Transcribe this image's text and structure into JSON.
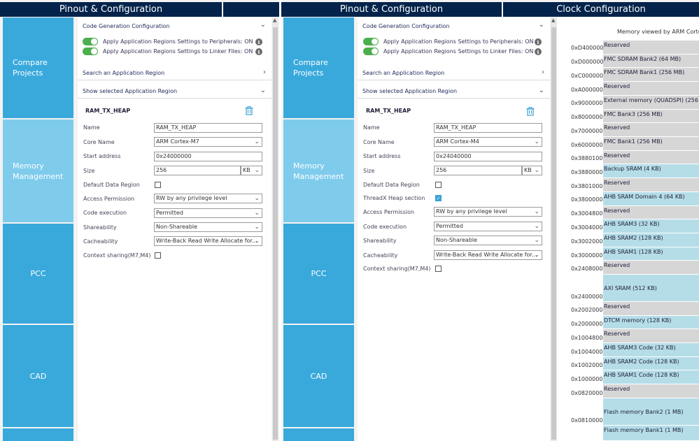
{
  "left": {
    "tabs": [
      "Pinout & Configuration"
    ],
    "sidebar": [
      {
        "label": "Compare Projects"
      },
      {
        "label": "Memory\nManagement"
      },
      {
        "label": "PCC"
      },
      {
        "label": "CAD"
      }
    ],
    "sections": {
      "code_gen": "Code Generation Configuration",
      "apply_periph": "Apply Application Regions Settings to Peripherals: ON",
      "apply_linker": "Apply Application Regions Settings to Linker Files: ON",
      "search": "Search an Application Region",
      "show_selected": "Show selected Application Region"
    },
    "region_title": "RAM_TX_HEAP",
    "fields": {
      "name_label": "Name",
      "name_value": "RAM_TX_HEAP",
      "core_label": "Core Name",
      "core_value": "ARM Cortex-M7",
      "start_label": "Start address",
      "start_value": "0x24000000",
      "size_label": "Size",
      "size_value": "256",
      "size_unit": "KB",
      "default_label": "Default Data Region",
      "access_label": "Access Permission",
      "access_value": "RW by any privilege level",
      "code_exec_label": "Code execution",
      "code_exec_value": "Permitted",
      "share_label": "Shareability",
      "share_value": "Non-Shareable",
      "cache_label": "Cacheability",
      "cache_value": "Write-Back Read Write Allocate for...",
      "context_label": "Context sharing(M7,M4)"
    }
  },
  "right": {
    "tabs": [
      "Pinout & Configuration",
      "Clock Configuration"
    ],
    "sidebar": [
      {
        "label": "Compare Projects"
      },
      {
        "label": "Memory\nManagement"
      },
      {
        "label": "PCC"
      },
      {
        "label": "CAD"
      }
    ],
    "sections": {
      "code_gen": "Code Generation Configuration",
      "apply_periph": "Apply Application Regions Settings to Peripherals: ON",
      "apply_linker": "Apply Application Regions Settings to Linker Files: ON",
      "search": "Search an Application Region",
      "show_selected": "Show selected Application Region"
    },
    "region_title": "RAM_TX_HEAP",
    "fields": {
      "name_label": "Name",
      "name_value": "RAM_TX_HEAP",
      "core_label": "Core Name",
      "core_value": "ARM Cortex-M4",
      "start_label": "Start address",
      "start_value": "0x24040000",
      "size_label": "Size",
      "size_value": "256",
      "size_unit": "KB",
      "default_label": "Default Data Region",
      "threadx_label": "ThreadX Heap section",
      "access_label": "Access Permission",
      "access_value": "RW by any privilege level",
      "code_exec_label": "Code execution",
      "code_exec_value": "Permitted",
      "share_label": "Shareability",
      "share_value": "Non-Shareable",
      "cache_label": "Cacheability",
      "cache_value": "Write-Back Read Write Allocate for...",
      "context_label": "Context sharing(M7,M4)"
    },
    "memory_map": {
      "title": "Memory viewed by ARM Corte",
      "addresses": [
        "0xD4000000",
        "0xD0000000",
        "0xC0000000",
        "0xA0000000",
        "0x90000000",
        "0x80000000",
        "0x70000000",
        "0x60000000",
        "0x38801000",
        "0x38800000",
        "0x38010000",
        "0x38000000",
        "0x30048000",
        "0x30040000",
        "0x30020000",
        "0x30000000",
        "0x24080000",
        "0x24000000",
        "0x20020000",
        "0x20000000",
        "0x10048000",
        "0x10040000",
        "0x10020000",
        "0x10000000",
        "0x08200000",
        "0x08100000"
      ],
      "blocks": [
        {
          "label": "Reserved",
          "kind": "reserved"
        },
        {
          "label": "FMC SDRAM Bank2 (64 MB)",
          "kind": "reserved"
        },
        {
          "label": "FMC SDRAM Bank1 (256 MB)",
          "kind": "reserved"
        },
        {
          "label": "Reserved",
          "kind": "reserved"
        },
        {
          "label": "External memory (QUADSPI) (256 M",
          "kind": "reserved"
        },
        {
          "label": "FMC Bank3 (256 MB)",
          "kind": "reserved"
        },
        {
          "label": "Reserved",
          "kind": "reserved"
        },
        {
          "label": "FMC Bank1 (256 MB)",
          "kind": "reserved"
        },
        {
          "label": "Reserved",
          "kind": "reserved"
        },
        {
          "label": "Backup SRAM (4 KB)",
          "kind": "used"
        },
        {
          "label": "Reserved",
          "kind": "reserved"
        },
        {
          "label": "AHB SRAM Domain 4 (64 KB)",
          "kind": "used"
        },
        {
          "label": "Reserved",
          "kind": "reserved"
        },
        {
          "label": "AHB SRAM3 (32 KB)",
          "kind": "used"
        },
        {
          "label": "AHB SRAM2 (128 KB)",
          "kind": "used"
        },
        {
          "label": "AHB SRAM1 (128 KB)",
          "kind": "used"
        },
        {
          "label": "Reserved",
          "kind": "reserved"
        },
        {
          "label": "AXI SRAM (512 KB)",
          "kind": "used"
        },
        {
          "label": "Reserved",
          "kind": "reserved"
        },
        {
          "label": "DTCM memory (128 KB)",
          "kind": "used"
        },
        {
          "label": "Reserved",
          "kind": "reserved"
        },
        {
          "label": "AHB SRAM3 Code (32 KB)",
          "kind": "used"
        },
        {
          "label": "AHB SRAM2 Code (128 KB)",
          "kind": "used"
        },
        {
          "label": "AHB SRAM1 Code (128 KB)",
          "kind": "used"
        },
        {
          "label": "Reserved",
          "kind": "reserved"
        },
        {
          "label": "Flash memory Bank2 (1 MB)",
          "kind": "used"
        },
        {
          "label": "Flash memory Bank1 (1 MB)",
          "kind": "used"
        }
      ]
    }
  },
  "colors": {
    "topbar": "#03234b",
    "sidebar": "#39a9dc",
    "sidebar_active": "#7ecbec",
    "toggle_on": "#4cae4c",
    "reserved": "#d6d6d6",
    "used": "#b5dde8"
  },
  "icons": [
    "info-icon",
    "trash-icon",
    "chevron-down-icon",
    "chevron-right-icon",
    "dropdown-arrow-icon",
    "checkmark-icon"
  ]
}
